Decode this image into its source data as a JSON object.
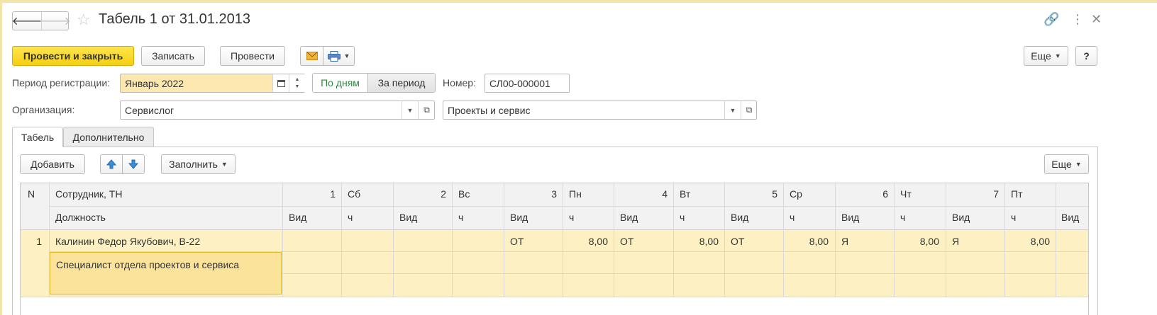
{
  "window": {
    "title": "Табель 1 от 31.01.2013"
  },
  "toolbar": {
    "post_close": "Провести и закрыть",
    "save": "Записать",
    "post": "Провести",
    "more": "Еще",
    "help": "?"
  },
  "form": {
    "period_label": "Период регистрации:",
    "period_value": "Январь 2022",
    "by_days": "По дням",
    "for_period": "За период",
    "number_label": "Номер:",
    "number_value": "СЛ00-000001",
    "org_label": "Организация:",
    "org_value": "Сервислог",
    "dept_value": "Проекты и сервис"
  },
  "tabs": [
    "Табель",
    "Дополнительно"
  ],
  "table_toolbar": {
    "add": "Добавить",
    "fill": "Заполнить",
    "more": "Еще"
  },
  "table": {
    "header_row1": {
      "n": "N",
      "employee": "Сотрудник, ТН",
      "days": [
        {
          "num": "1",
          "dow": "Сб"
        },
        {
          "num": "2",
          "dow": "Вс"
        },
        {
          "num": "3",
          "dow": "Пн"
        },
        {
          "num": "4",
          "dow": "Вт"
        },
        {
          "num": "5",
          "dow": "Ср"
        },
        {
          "num": "6",
          "dow": "Чт"
        },
        {
          "num": "7",
          "dow": "Пт"
        }
      ]
    },
    "header_row2": {
      "position": "Должность",
      "kind": "Вид",
      "hours": "ч"
    },
    "rows": [
      {
        "n": "1",
        "employee": "Калинин Федор Якубович, В-22",
        "position": "Специалист отдела проектов и сервиса",
        "days": [
          {
            "kind": "",
            "hours": ""
          },
          {
            "kind": "",
            "hours": ""
          },
          {
            "kind": "ОТ",
            "hours": "8,00"
          },
          {
            "kind": "ОТ",
            "hours": "8,00"
          },
          {
            "kind": "ОТ",
            "hours": "8,00"
          },
          {
            "kind": "Я",
            "hours": "8,00"
          },
          {
            "kind": "Я",
            "hours": "8,00"
          }
        ]
      }
    ]
  },
  "colors": {
    "accent_yellow": "#f5cf14",
    "row_highlight": "#fdf1c4",
    "toggle_on_text": "#2a8a3a"
  }
}
